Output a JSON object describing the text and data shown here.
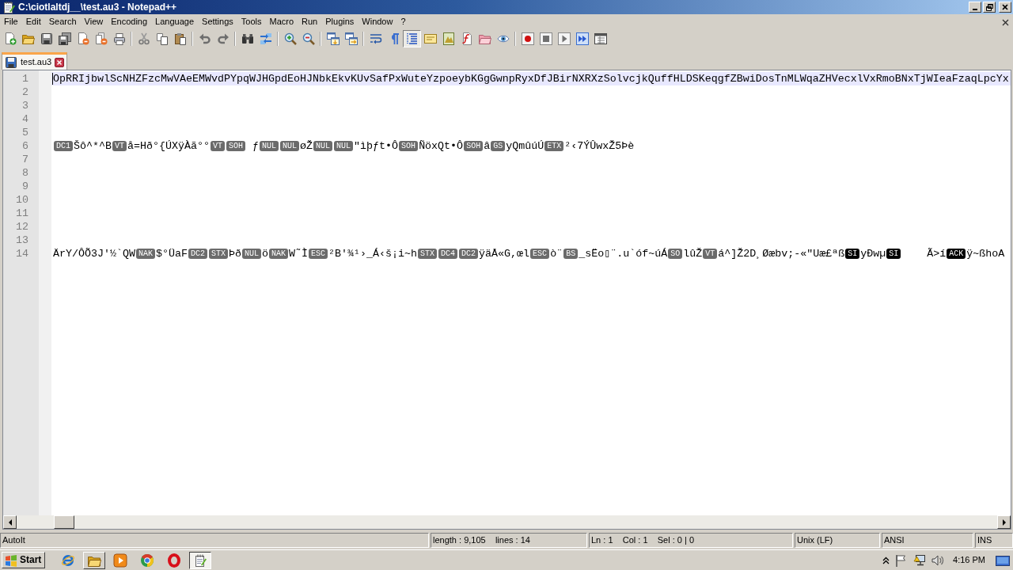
{
  "window": {
    "title": "C:\\ciotlaltdj__\\test.au3 - Notepad++"
  },
  "menu": [
    "File",
    "Edit",
    "Search",
    "View",
    "Encoding",
    "Language",
    "Settings",
    "Tools",
    "Macro",
    "Run",
    "Plugins",
    "Window",
    "?"
  ],
  "toolbar": [
    [
      {
        "pressed": false
      },
      {
        "pressed": false
      },
      {
        "pressed": false
      },
      {
        "pressed": false
      },
      {
        "pressed": false
      },
      {
        "pressed": false
      },
      {
        "pressed": false
      }
    ],
    [
      {
        "pressed": false
      },
      {
        "pressed": false
      },
      {
        "pressed": false
      }
    ],
    [
      {
        "pressed": false
      },
      {
        "pressed": false
      }
    ],
    [
      {
        "pressed": false
      },
      {
        "pressed": false
      }
    ],
    [
      {
        "pressed": false
      },
      {
        "pressed": false
      }
    ],
    [
      {
        "pressed": false
      },
      {
        "pressed": false
      }
    ],
    [
      {
        "pressed": false
      },
      {
        "pressed": false
      },
      {
        "pressed": true
      },
      {
        "pressed": false
      },
      {
        "pressed": false
      },
      {
        "pressed": false
      },
      {
        "pressed": false
      },
      {
        "pressed": false
      }
    ],
    [
      {
        "pressed": false
      },
      {
        "pressed": false
      },
      {
        "pressed": false
      },
      {
        "pressed": false
      },
      {
        "pressed": false
      }
    ]
  ],
  "tabs": [
    {
      "label": "test.au3",
      "selected": true
    }
  ],
  "editor": {
    "lines": [
      {
        "number": "1",
        "current": true,
        "segments": [
          {
            "kind": "text",
            "text": "OpRRIjbwlScNHZFzcMwVAeEMWvdPYpqWJHGpdEoHJNbkEkvKUvSafPxWuteYzpoeybKGgGwnpRyxDfJBirNXRXzSolvcjkQuffHLDSKeqgfZBwiDosTnMLWqaZHVecxlVxRmoBNxTjWIeaFzaqLpcYx"
          }
        ]
      },
      {
        "number": "2",
        "current": false
      },
      {
        "number": "3",
        "current": false
      },
      {
        "number": "4",
        "current": false
      },
      {
        "number": "5",
        "current": false
      },
      {
        "number": "6",
        "current": false,
        "segments": [
          {
            "kind": "control",
            "text": "DC1",
            "dark": false
          },
          {
            "kind": "text",
            "text": "Šô^*^B"
          },
          {
            "kind": "control",
            "text": "VT",
            "dark": false
          },
          {
            "kind": "text",
            "text": "å=Hð°{ÚXÿÀã°°"
          },
          {
            "kind": "control",
            "text": "VT",
            "dark": false
          },
          {
            "kind": "control",
            "text": "SOH",
            "dark": false
          },
          {
            "kind": "text",
            "text": " ƒ"
          },
          {
            "kind": "control",
            "text": "NUL",
            "dark": false
          },
          {
            "kind": "control",
            "text": "NUL",
            "dark": false
          },
          {
            "kind": "text",
            "text": "øŽ"
          },
          {
            "kind": "control",
            "text": "NUL",
            "dark": false
          },
          {
            "kind": "control",
            "text": "NUL",
            "dark": false
          },
          {
            "kind": "text",
            "text": "\"ìþƒt•Ô"
          },
          {
            "kind": "control",
            "text": "SOH",
            "dark": false
          },
          {
            "kind": "text",
            "text": "ÑöxQt•Ô"
          },
          {
            "kind": "control",
            "text": "SOH",
            "dark": false
          },
          {
            "kind": "text",
            "text": "â"
          },
          {
            "kind": "control",
            "text": "GS",
            "dark": false
          },
          {
            "kind": "text",
            "text": "yQmûúÚ"
          },
          {
            "kind": "control",
            "text": "ETX",
            "dark": false
          },
          {
            "kind": "text",
            "text": "²‹7ÝÛwxŽ5Þè"
          }
        ]
      },
      {
        "number": "7",
        "current": false
      },
      {
        "number": "8",
        "current": false
      },
      {
        "number": "9",
        "current": false
      },
      {
        "number": "10",
        "current": false
      },
      {
        "number": "11",
        "current": false
      },
      {
        "number": "12",
        "current": false
      },
      {
        "number": "13",
        "current": false
      },
      {
        "number": "14",
        "current": false,
        "segments": [
          {
            "kind": "text",
            "text": "ÄrY/ÔÕ3J'½`QW"
          },
          {
            "kind": "control",
            "text": "NAK",
            "dark": false
          },
          {
            "kind": "text",
            "text": "$°ÜaF"
          },
          {
            "kind": "control",
            "text": "DC2",
            "dark": false
          },
          {
            "kind": "control",
            "text": "STX",
            "dark": false
          },
          {
            "kind": "text",
            "text": "Þð"
          },
          {
            "kind": "control",
            "text": "NUL",
            "dark": false
          },
          {
            "kind": "text",
            "text": "ö"
          },
          {
            "kind": "control",
            "text": "NAK",
            "dark": false
          },
          {
            "kind": "text",
            "text": "W˜Ì"
          },
          {
            "kind": "control",
            "text": "ESC",
            "dark": false
          },
          {
            "kind": "text",
            "text": "²B'¾¹›_Á‹š¡i~h"
          },
          {
            "kind": "control",
            "text": "STX",
            "dark": false
          },
          {
            "kind": "control",
            "text": "DC4",
            "dark": false
          },
          {
            "kind": "control",
            "text": "DC2",
            "dark": false
          },
          {
            "kind": "text",
            "text": "ÿäÅ«G,œl"
          },
          {
            "kind": "control",
            "text": "ESC",
            "dark": false
          },
          {
            "kind": "text",
            "text": "ò¨"
          },
          {
            "kind": "control",
            "text": "BS",
            "dark": false
          },
          {
            "kind": "text",
            "text": "_sËo▯¨.u`óf~úÁ"
          },
          {
            "kind": "control",
            "text": "SO",
            "dark": false
          },
          {
            "kind": "text",
            "text": "lûŽ"
          },
          {
            "kind": "control",
            "text": "VT",
            "dark": false
          },
          {
            "kind": "text",
            "text": "á^]Ž2D¸Øæbv;-«\"Uæ£ªß"
          },
          {
            "kind": "control",
            "text": "SI",
            "dark": true
          },
          {
            "kind": "text",
            "text": "yÐwµ"
          },
          {
            "kind": "control",
            "text": "SI",
            "dark": true
          },
          {
            "kind": "text",
            "text": "    Ã>í"
          },
          {
            "kind": "control",
            "text": "ACK",
            "dark": true
          },
          {
            "kind": "text",
            "text": "ÿ~ßhoA"
          }
        ]
      }
    ]
  },
  "status_bar": [
    "AutoIt",
    "length : 9,105    lines : 14",
    "Ln : 1    Col : 1    Sel : 0 | 0",
    "Unix (LF)",
    "ANSI",
    "INS"
  ],
  "taskbar": {
    "start": "Start",
    "items": [
      {
        "running": false,
        "active": false
      },
      {
        "running": true,
        "active": false
      },
      {
        "running": false,
        "active": false
      },
      {
        "running": false,
        "active": false
      },
      {
        "running": false,
        "active": false
      },
      {
        "running": true,
        "active": true
      }
    ],
    "clock": "4:16 PM"
  }
}
